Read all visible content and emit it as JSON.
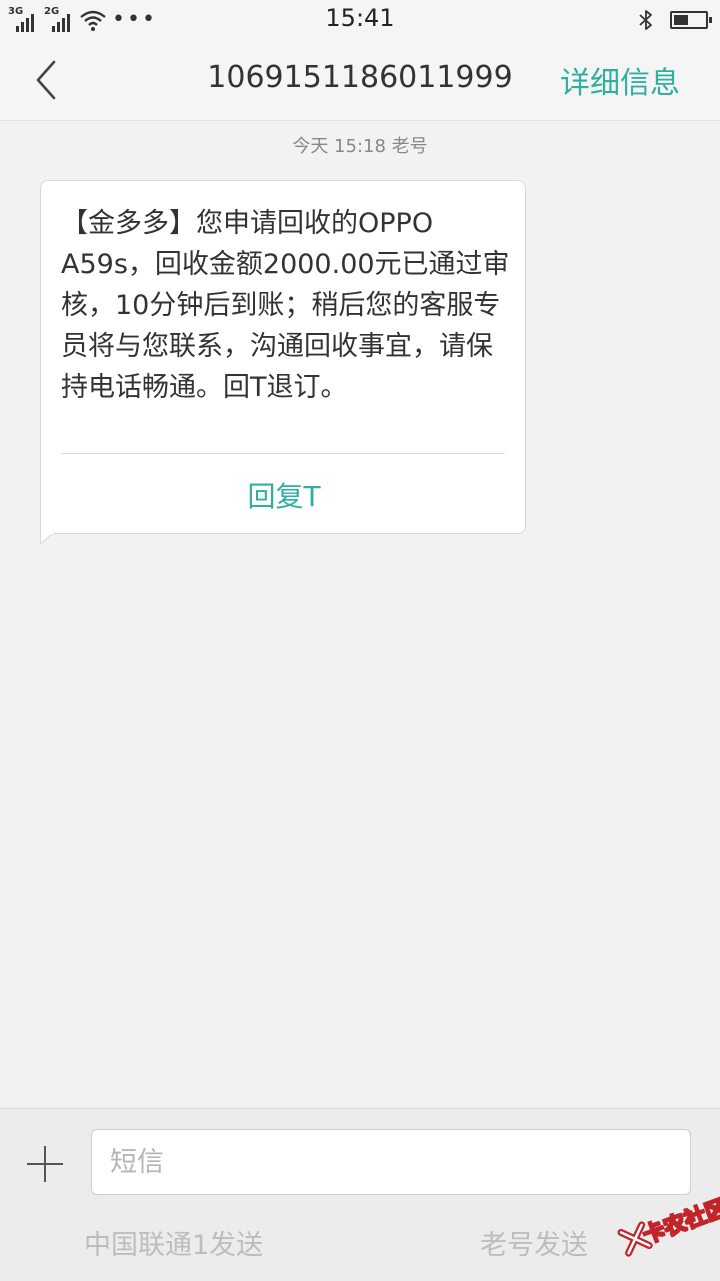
{
  "status_bar": {
    "network_1": "3G",
    "network_2": "2G",
    "more": "•••",
    "time": "15:41",
    "icons": [
      "signal-icon",
      "wifi-icon",
      "bluetooth-icon",
      "battery-icon"
    ],
    "battery_level": 0.45
  },
  "header": {
    "title": "1069151186011999",
    "detail_label": "详细信息",
    "back_icon": "chevron-left-icon"
  },
  "thread": {
    "timestamp": "今天  15:18  老号",
    "message": {
      "text": "【金多多】您申请回收的OPPO A59s，回收金额2000.00元已通过审核，10分钟后到账；稍后您的客服专员将与您联系，沟通回收事宜，请保持电话畅通。回T退订。",
      "reply_label": "回复T"
    }
  },
  "composer": {
    "add_icon": "plus-icon",
    "placeholder": "短信",
    "value": "",
    "send_sim1": "中国联通1发送",
    "send_sim2": "老号发送"
  },
  "watermark": {
    "text": "卡农社区"
  },
  "colors": {
    "accent": "#2faf9f",
    "background": "#f2f2f2",
    "bar": "#f5f5f5",
    "muted": "#bdbdbd",
    "watermark": "#c3242a"
  }
}
